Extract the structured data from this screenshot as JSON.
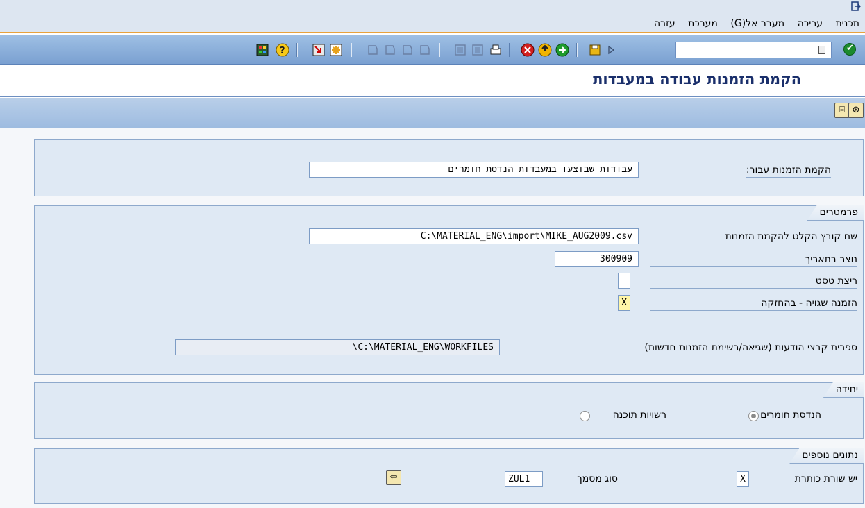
{
  "menu": {
    "items": [
      "תכנית",
      "עריכה",
      "מעבר אל(G)",
      "מערכת",
      "עזרה"
    ]
  },
  "toolbar": {
    "command_value": "",
    "icons": [
      "ok-icon",
      "save-icon",
      "back-icon",
      "exit-icon",
      "cancel-icon",
      "print-icon",
      "find-icon",
      "find-next-icon",
      "first-page-icon",
      "prev-page-icon",
      "next-page-icon",
      "last-page-icon",
      "new-session-icon",
      "shortcut-icon",
      "help-icon",
      "layout-icon"
    ]
  },
  "title": "הקמת הזמנות עבודה במעבדות",
  "apptoolbar": {
    "buttons": [
      "execute-icon",
      "variant-icon"
    ]
  },
  "group1": {
    "label": "הקמת הזמנות עבור:",
    "value": "עבודות שבוצעו במעבדות הנדסת חומרים"
  },
  "params": {
    "title": "פרמטרים",
    "file_label": "שם קובץ הקלט להקמת הזמנות",
    "file_value": "C:\\MATERIAL_ENG\\import\\MIKE_AUG2009.csv",
    "date_label": "נוצר בתאריך",
    "date_value": "300909",
    "test_label": "ריצת טסט",
    "test_value": "",
    "hold_label": "הזמנה שגויה - בהחזקה",
    "hold_value": "X",
    "folder_label": "ספרית קבצי הודעות (שגיאה/רשימת הזמנות חדשות)",
    "folder_value": "\\C:\\MATERIAL_ENG\\WORKFILES"
  },
  "unit": {
    "title": "יחידה",
    "option1": "הנדסת חומרים",
    "option2": "רשויות תוכנה",
    "selected": "הנדסת חומרים"
  },
  "extra": {
    "title": "נתונים נוספים",
    "header_label": "יש שורת כותרת",
    "header_value": "X",
    "doctype_label": "סוג מסמך",
    "doctype_value": "ZUL1"
  }
}
